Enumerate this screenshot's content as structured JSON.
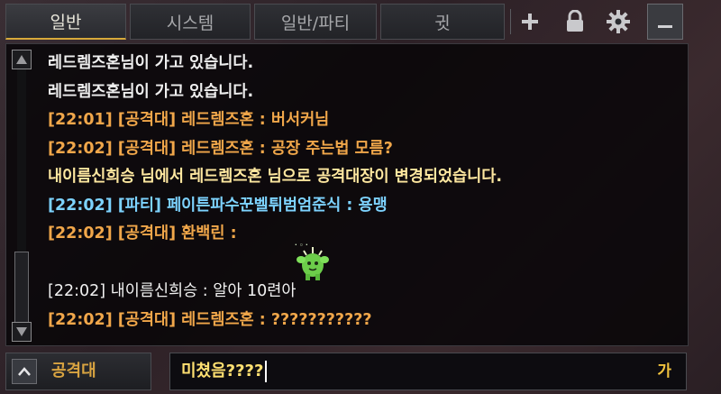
{
  "tabs": [
    {
      "label": "일반",
      "active": true
    },
    {
      "label": "시스템",
      "active": false
    },
    {
      "label": "일반/파티",
      "active": false
    },
    {
      "label": "귓",
      "active": false
    }
  ],
  "toolbar_icons": [
    "plus-icon",
    "lock-icon",
    "gear-icon",
    "minimize-icon"
  ],
  "messages": [
    {
      "text": "레드렘즈혼님이 가고 있습니다.",
      "color": "white"
    },
    {
      "text": "레드렘즈혼님이 가고 있습니다.",
      "color": "white"
    },
    {
      "text": "[22:01] [공격대] 레드렘즈혼 : 버서커님",
      "color": "orange"
    },
    {
      "text": "[22:02] [공격대] 레드렘즈혼 : 공장 주는법 모름?",
      "color": "orange"
    },
    {
      "text": "내이름신희승 님에서 레드렘즈혼 님으로 공격대장이 변경되었습니다.",
      "color": "gold"
    },
    {
      "text": "[22:02] [파티] 페이튼파수꾼벨튀범엄준식 : 용맹",
      "color": "blue"
    },
    {
      "text": "[22:02] [공격대] 환백린 :",
      "color": "orange",
      "emoticon": "green-cactus-emoticon"
    },
    {
      "text": "[22:02] 내이름신희승 : 알아 10련아",
      "color": "plain"
    },
    {
      "text": "[22:02] [공격대] 레드렘즈혼 : ???????????",
      "color": "orange"
    }
  ],
  "input": {
    "channel": "공격대",
    "value": "미쳤음????",
    "ime_indicator": "가"
  },
  "colors": {
    "active_tab_underline": "#d7a93a",
    "raid": "#f1a74a",
    "party": "#7dd3ff",
    "system": "#ffe8a0",
    "input_text": "#ffe071"
  }
}
